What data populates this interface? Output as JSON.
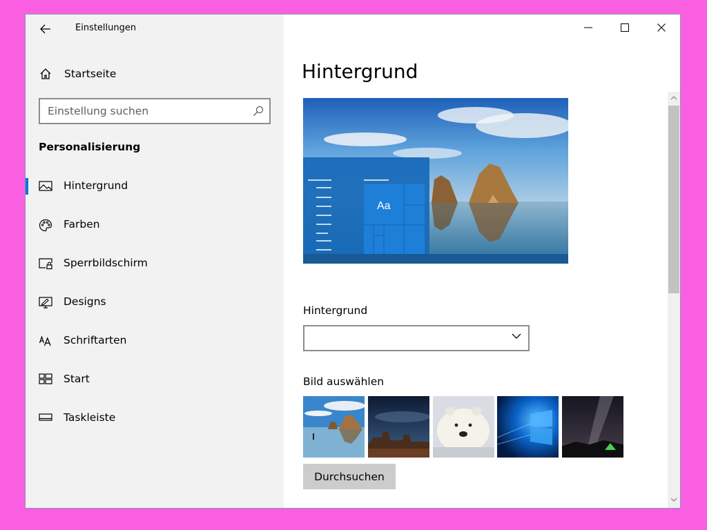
{
  "window": {
    "app_title": "Einstellungen",
    "controls": {
      "minimize": "minimize-icon",
      "maximize": "maximize-icon",
      "close": "close-icon"
    }
  },
  "sidebar": {
    "home_label": "Startseite",
    "search_placeholder": "Einstellung suchen",
    "section_title": "Personalisierung",
    "items": [
      {
        "label": "Hintergrund",
        "icon": "picture-icon",
        "selected": true
      },
      {
        "label": "Farben",
        "icon": "palette-icon",
        "selected": false
      },
      {
        "label": "Sperrbildschirm",
        "icon": "lock-screen-icon",
        "selected": false
      },
      {
        "label": "Designs",
        "icon": "themes-icon",
        "selected": false
      },
      {
        "label": "Schriftarten",
        "icon": "fonts-icon",
        "selected": false
      },
      {
        "label": "Start",
        "icon": "start-icon",
        "selected": false
      },
      {
        "label": "Taskleiste",
        "icon": "taskbar-icon",
        "selected": false
      }
    ]
  },
  "main": {
    "title": "Hintergrund",
    "preview": {
      "tile_text": "Aa"
    },
    "background_label": "Hintergrund",
    "background_value": "",
    "choose_image_label": "Bild auswählen",
    "thumbnails": [
      {
        "name": "beach-rock-arch"
      },
      {
        "name": "desert-night-sky"
      },
      {
        "name": "polar-bear"
      },
      {
        "name": "windows-logo-light"
      },
      {
        "name": "milky-way-camping"
      }
    ],
    "browse_label": "Durchsuchen"
  },
  "colors": {
    "accent": "#0078d7",
    "sidebar_bg": "#f2f2f2",
    "frame": "#fb5fe1"
  }
}
